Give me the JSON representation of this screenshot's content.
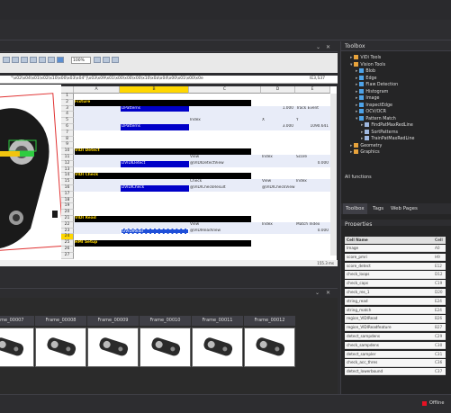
{
  "document": {
    "controls": [
      "⌄",
      "✕"
    ]
  },
  "ribbon": {
    "zoom": "100%"
  },
  "formula": {
    "value": "\"\\x02\\x04\\x01\\x02\\x10\\x00\\x03\\x04\"]\\x03\\x09\\x01\\x00\\x00\\x00\\x10\\x0a\\x04\\x00\\x01\\x00\\x0e",
    "cellref": "IE3,S37"
  },
  "grid": {
    "columns": [
      "A",
      "B",
      "C",
      "D",
      "E"
    ],
    "rows": [
      {
        "n": "1",
        "a": "",
        "b": "",
        "c": "",
        "d": "",
        "e": ""
      },
      {
        "n": "2",
        "a": "Fixture",
        "b": "",
        "c": "",
        "d": "",
        "e": ""
      },
      {
        "n": "3",
        "a": "",
        "b": "DPatterns",
        "c": "",
        "d": "1.000",
        "e": "Track Event"
      },
      {
        "n": "4",
        "a": "",
        "b": "",
        "c": "",
        "d": "",
        "e": ""
      },
      {
        "n": "5",
        "a": "",
        "b": "",
        "c": "Index",
        "d": "X",
        "e": "Y"
      },
      {
        "n": "6",
        "a": "",
        "b": "DPatterns",
        "c": "",
        "d": "3.000",
        "e": "1090.641"
      },
      {
        "n": "7",
        "a": "",
        "b": "",
        "c": "",
        "d": "",
        "e": ""
      },
      {
        "n": "8",
        "a": "",
        "b": "",
        "c": "",
        "d": "",
        "e": ""
      },
      {
        "n": "9",
        "a": "",
        "b": "",
        "c": "",
        "d": "",
        "e": ""
      },
      {
        "n": "10",
        "a": "VIDI Detect",
        "b": "",
        "c": "",
        "d": "",
        "e": ""
      },
      {
        "n": "11",
        "a": "",
        "b": "",
        "c": "View",
        "d": "Index",
        "e": "Score"
      },
      {
        "n": "12",
        "a": "",
        "b": "DVIDIDetect",
        "c": "@VIDIDetectView",
        "d": "",
        "e": "0.000"
      },
      {
        "n": "13",
        "a": "",
        "b": "",
        "c": "",
        "d": "",
        "e": ""
      },
      {
        "n": "14",
        "a": "VIDI Check",
        "b": "",
        "c": "",
        "d": "",
        "e": ""
      },
      {
        "n": "15",
        "a": "",
        "b": "",
        "c": "Check",
        "d": "View",
        "e": "Index"
      },
      {
        "n": "16",
        "a": "",
        "b": "DVIDICheck",
        "c": "@VIDICheckResult",
        "d": "@VIDICheckView",
        "e": ""
      },
      {
        "n": "17",
        "a": "",
        "b": "",
        "c": "",
        "d": "",
        "e": ""
      },
      {
        "n": "18",
        "a": "",
        "b": "",
        "c": "",
        "d": "",
        "e": ""
      },
      {
        "n": "19",
        "a": "",
        "b": "",
        "c": "",
        "d": "",
        "e": ""
      },
      {
        "n": "20",
        "a": "",
        "b": "",
        "c": "",
        "d": "",
        "e": ""
      },
      {
        "n": "21",
        "a": "VIDI Read",
        "b": "",
        "c": "",
        "d": "",
        "e": ""
      },
      {
        "n": "22",
        "a": "",
        "b": "",
        "c": "View",
        "d": "Index",
        "e": "Match Index"
      },
      {
        "n": "23",
        "a": "",
        "b": "DVIDIRead",
        "c": "@VIDIReadView",
        "d": "",
        "e": "0.000"
      },
      {
        "n": "24",
        "a": "",
        "b": "",
        "c": "",
        "d": "",
        "e": ""
      },
      {
        "n": "25",
        "a": "HMI Setup",
        "b": "",
        "c": "",
        "d": "",
        "e": ""
      },
      {
        "n": "26",
        "a": "",
        "b": "",
        "c": "",
        "d": "",
        "e": ""
      },
      {
        "n": "27",
        "a": "",
        "b": "",
        "c": "",
        "d": "",
        "e": ""
      }
    ]
  },
  "status": {
    "zoom": "155.3 ms"
  },
  "frames": [
    "Frame_00007",
    "Frame_00008",
    "Frame_00009",
    "Frame_00010",
    "Frame_00011",
    "Frame_00012"
  ],
  "toolbox": {
    "title": "Toolbox",
    "items": [
      {
        "label": "ViDi Tools",
        "indent": 1,
        "open": false
      },
      {
        "label": "Vision Tools",
        "indent": 1,
        "open": true
      },
      {
        "label": "Blob",
        "indent": 2,
        "open": false
      },
      {
        "label": "Edge",
        "indent": 2,
        "open": false
      },
      {
        "label": "Flaw Detection",
        "indent": 2,
        "open": false
      },
      {
        "label": "Histogram",
        "indent": 2,
        "open": false
      },
      {
        "label": "Image",
        "indent": 2,
        "open": false
      },
      {
        "label": "InspectEdge",
        "indent": 2,
        "open": false
      },
      {
        "label": "OCV/OCR",
        "indent": 2,
        "open": false
      },
      {
        "label": "Pattern Match",
        "indent": 2,
        "open": true
      },
      {
        "label": "FindPatMaxRedLine",
        "indent": 3,
        "open": false
      },
      {
        "label": "SortPatterns",
        "indent": 3,
        "open": false
      },
      {
        "label": "TrainPatMaxRedLine",
        "indent": 3,
        "open": false
      },
      {
        "label": "Geometry",
        "indent": 1,
        "open": false
      },
      {
        "label": "Graphics",
        "indent": 1,
        "open": false
      }
    ],
    "footer": "All functions",
    "tabs": [
      "Toolbox",
      "Tags",
      "Web Pages"
    ]
  },
  "properties": {
    "title": "Properties",
    "header": {
      "name": "Cell Name",
      "cell": "Cell"
    },
    "rows": [
      {
        "name": "Image",
        "cell": "A0"
      },
      {
        "name": "score_pmri",
        "cell": "H9"
      },
      {
        "name": "score_detect",
        "cell": "E12"
      },
      {
        "name": "check_loops",
        "cell": "D12"
      },
      {
        "name": "check_caps",
        "cell": "C19"
      },
      {
        "name": "check_res_1",
        "cell": "D20"
      },
      {
        "name": "string_read",
        "cell": "E24"
      },
      {
        "name": "string_match",
        "cell": "E24"
      },
      {
        "name": "region_VIDIRead",
        "cell": "B26"
      },
      {
        "name": "region_VIDIReadfeature",
        "cell": "B27"
      },
      {
        "name": "detect_sampdens",
        "cell": "C29"
      },
      {
        "name": "check_sampdens",
        "cell": "C30"
      },
      {
        "name": "detect_sampler",
        "cell": "C31"
      },
      {
        "name": "check_acc_thres",
        "cell": "C36"
      },
      {
        "name": "detect_lowerbound",
        "cell": "C37"
      }
    ]
  },
  "footer": {
    "offline": "Offline"
  },
  "colors": {
    "selected": "#0000c8",
    "section": "#000000",
    "accent": "#ffd700",
    "offline": "#e81123"
  }
}
